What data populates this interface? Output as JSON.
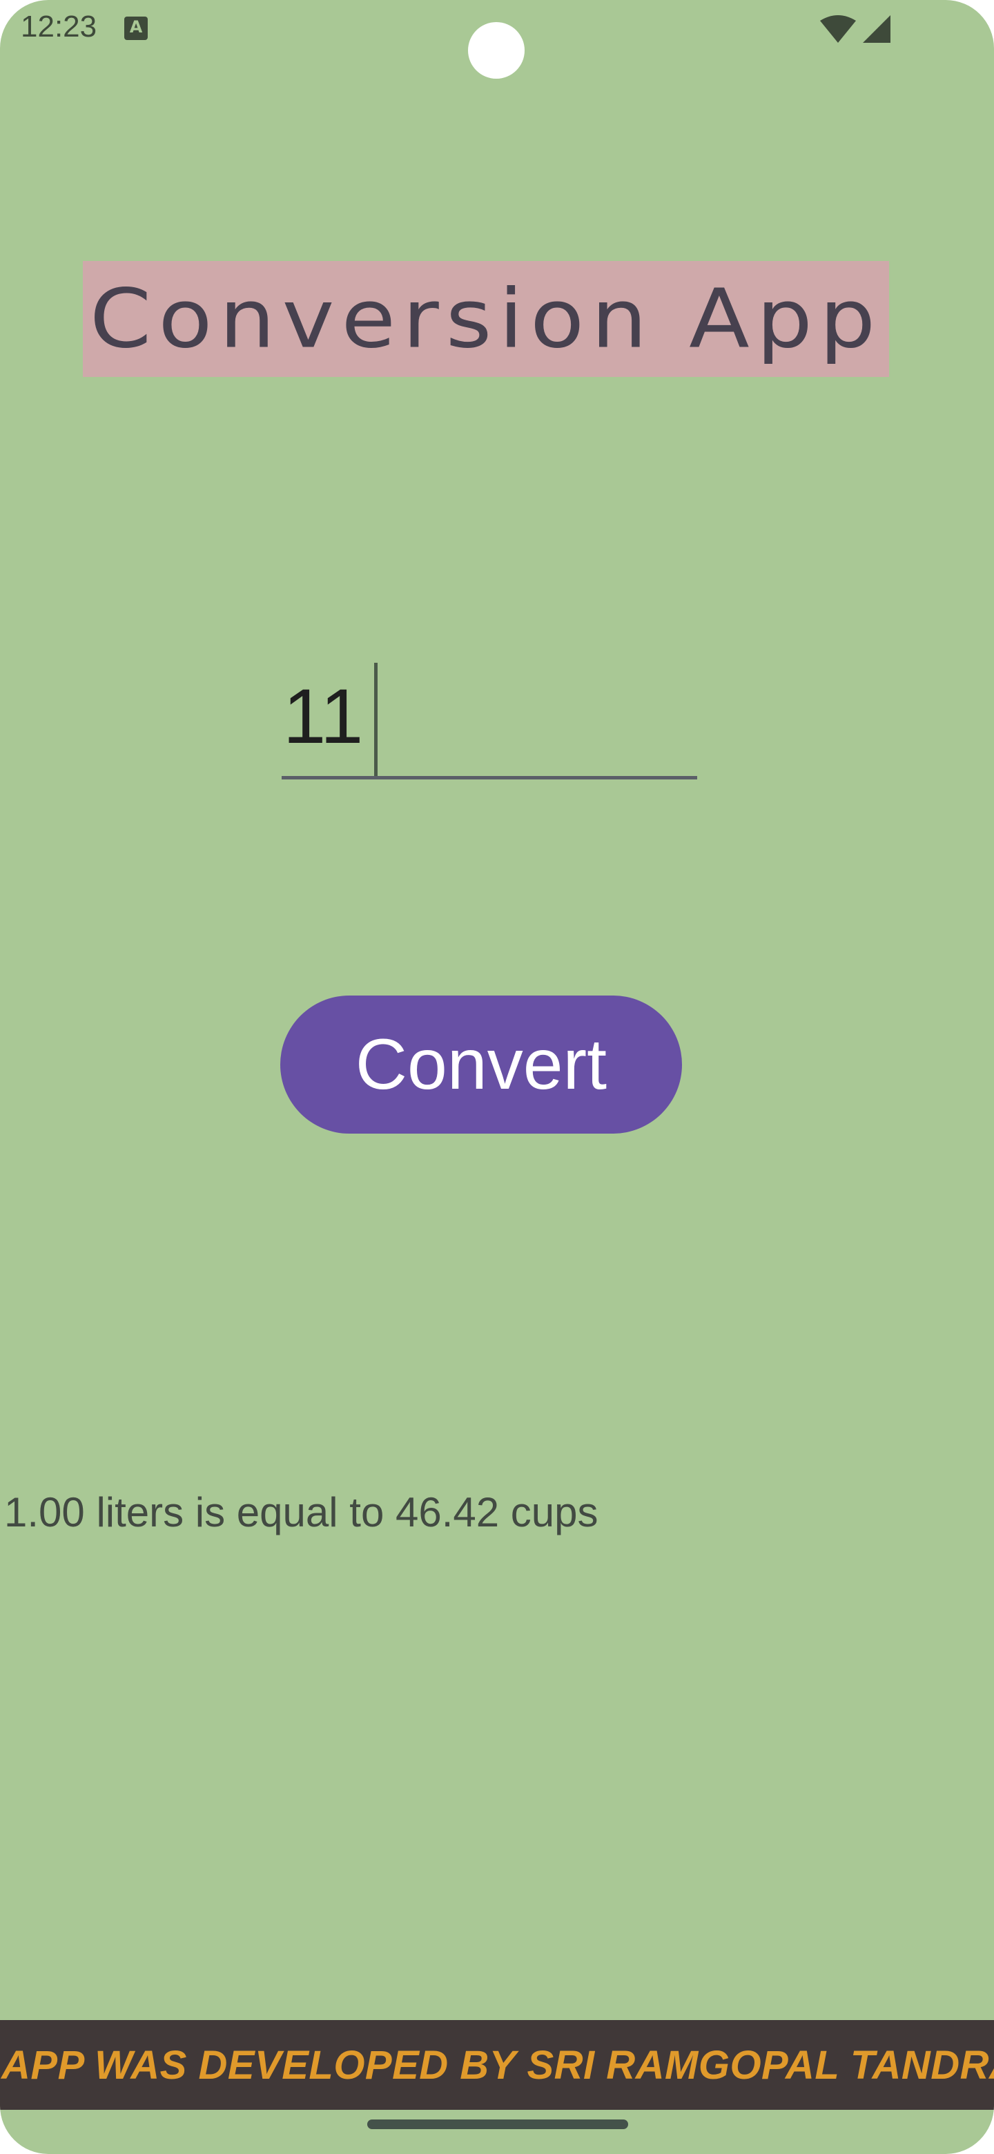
{
  "status_bar": {
    "time": "12:23",
    "notification_icon": "a-icon",
    "wifi_icon": "wifi-icon",
    "signal_icon": "signal-icon"
  },
  "app": {
    "title": "Conversion App",
    "input": {
      "value": "11",
      "placeholder": ""
    },
    "convert_button_label": "Convert",
    "result_text": "1.00 liters is equal to 46.42 cups",
    "footer_text": "APP WAS DEVELOPED BY SRI RAMGOPAL TANDRA"
  },
  "colors": {
    "background": "#a9c895",
    "title_bg": "#cfa9aa",
    "title_text": "#47414f",
    "button": "#6750a4",
    "footer_bg": "#403838",
    "footer_text": "#e09a2b"
  }
}
